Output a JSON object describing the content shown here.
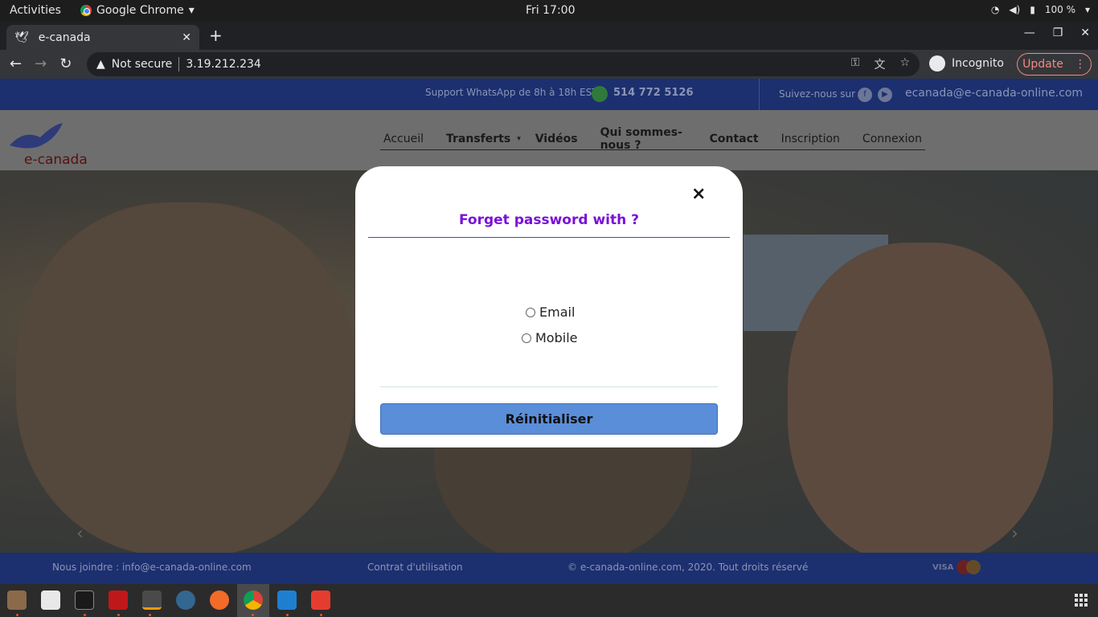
{
  "system": {
    "activities": "Activities",
    "app_name": "Google Chrome",
    "clock": "Fri 17:00",
    "battery": "100 %"
  },
  "browser": {
    "tab_title": "e-canada",
    "security_label": "Not secure",
    "url": "3.19.212.234",
    "profile_label": "Incognito",
    "update_label": "Update"
  },
  "site": {
    "support_text": "Support WhatsApp de 8h à 18h EST",
    "phone": "514 772 5126",
    "follow_text": "Suivez-nous sur",
    "email": "ecanada@e-canada-online.com",
    "brand": "e-canada",
    "nav": [
      "Accueil",
      "Transferts",
      "Vidéos",
      "Qui sommes-nous ?",
      "Contact",
      "Inscription",
      "Connexion"
    ],
    "footer": {
      "contact": "Nous joindre : info@e-canada-online.com",
      "terms": "Contrat d'utilisation",
      "copyright": "© e-canada-online.com, 2020. Tout droits réservé",
      "visa": "VISA"
    }
  },
  "modal": {
    "close_symbol": "×",
    "title": "Forget password with ?",
    "options": [
      "Email",
      "Mobile"
    ],
    "submit_label": "Réinitialiser"
  },
  "icons": [
    "chrome-icon",
    "wifi-icon",
    "volume-icon",
    "battery-icon",
    "back-icon",
    "forward-icon",
    "reload-icon",
    "warning-icon",
    "key-icon",
    "translate-icon",
    "star-icon",
    "whatsapp-icon",
    "facebook-icon",
    "youtube-icon",
    "close-icon"
  ]
}
